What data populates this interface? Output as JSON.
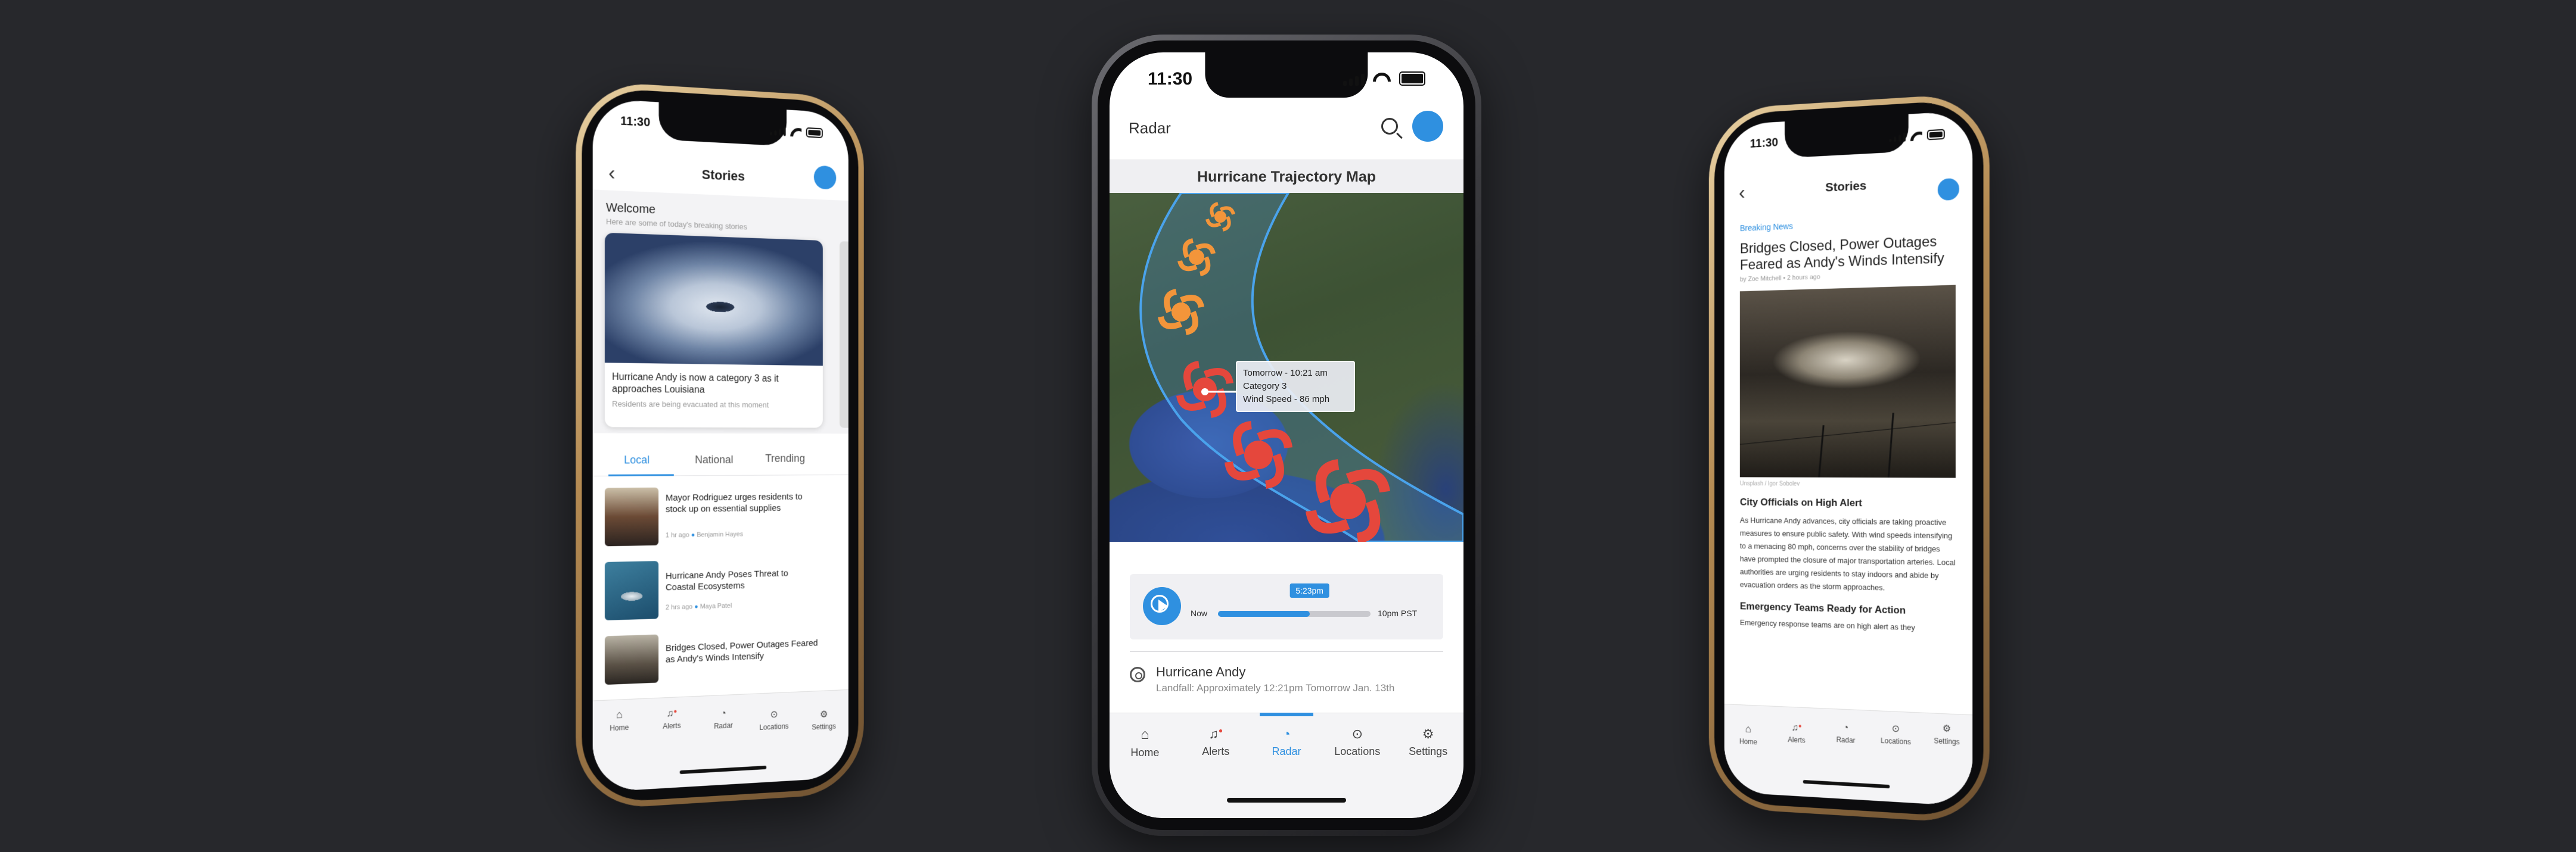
{
  "colors": {
    "accent": "#2f90e0",
    "hurricane": "#e5473c",
    "storm_icon": "#f3953a"
  },
  "status_time": "11:30",
  "left_phone": {
    "nav_title": "Stories",
    "welcome": {
      "title": "Welcome",
      "subtitle": "Here are some of today's breaking stories"
    },
    "featured": {
      "headline": "Hurricane Andy is now a category 3 as it approaches Louisiana",
      "sub": "Residents are being evacuated at this moment"
    },
    "tabs": [
      "Local",
      "National",
      "Trending"
    ],
    "active_tab": "Local",
    "stories": [
      {
        "title": "Mayor Rodriguez urges residents to stock up on essential supplies",
        "time": "1 hr ago",
        "author": "Benjamin Hayes"
      },
      {
        "title": "Hurricane Andy Poses Threat to Coastal Ecosystems",
        "time": "2 hrs ago",
        "author": "Maya Patel"
      },
      {
        "title": "Bridges Closed, Power Outages Feared as Andy's Winds Intensify",
        "time": "",
        "author": ""
      }
    ],
    "tabbar": [
      "Home",
      "Alerts",
      "Radar",
      "Locations",
      "Settings"
    ]
  },
  "center_phone": {
    "app_title": "Radar",
    "map_title": "Hurricane Trajectory Map",
    "tooltip": {
      "line1": "Tomorrow - 10:21 am",
      "line2": "Category 3",
      "line3": "Wind Speed - 86 mph"
    },
    "player": {
      "start_label": "Now",
      "end_label": "10pm PST",
      "current": "5:23pm",
      "progress": 0.6
    },
    "storm": {
      "name": "Hurricane Andy",
      "detail": "Landfall: Approximately 12:21pm Tomorrow Jan. 13th"
    },
    "tabbar": [
      "Home",
      "Alerts",
      "Radar",
      "Locations",
      "Settings"
    ],
    "active_tab": "Radar"
  },
  "right_phone": {
    "nav_title": "Stories",
    "tag": "Breaking News",
    "headline": "Bridges Closed, Power Outages Feared as Andy's Winds Intensify",
    "byline": "by Zoe Mitchell • 2 hours ago",
    "caption": "Unsplash / Igor Sobolev",
    "section1": {
      "title": "City Officials on High Alert",
      "body": "As Hurricane Andy advances, city officials are taking proactive measures to ensure public safety. With wind speeds intensifying to a menacing 80 mph, concerns over the stability of bridges have prompted the closure of major transportation arteries. Local authorities are urging residents to stay indoors and abide by evacuation orders as the storm approaches."
    },
    "section2": {
      "title": "Emergency Teams Ready for Action",
      "body": "Emergency response teams are on high alert as they"
    },
    "tabbar": [
      "Home",
      "Alerts",
      "Radar",
      "Locations",
      "Settings"
    ]
  }
}
